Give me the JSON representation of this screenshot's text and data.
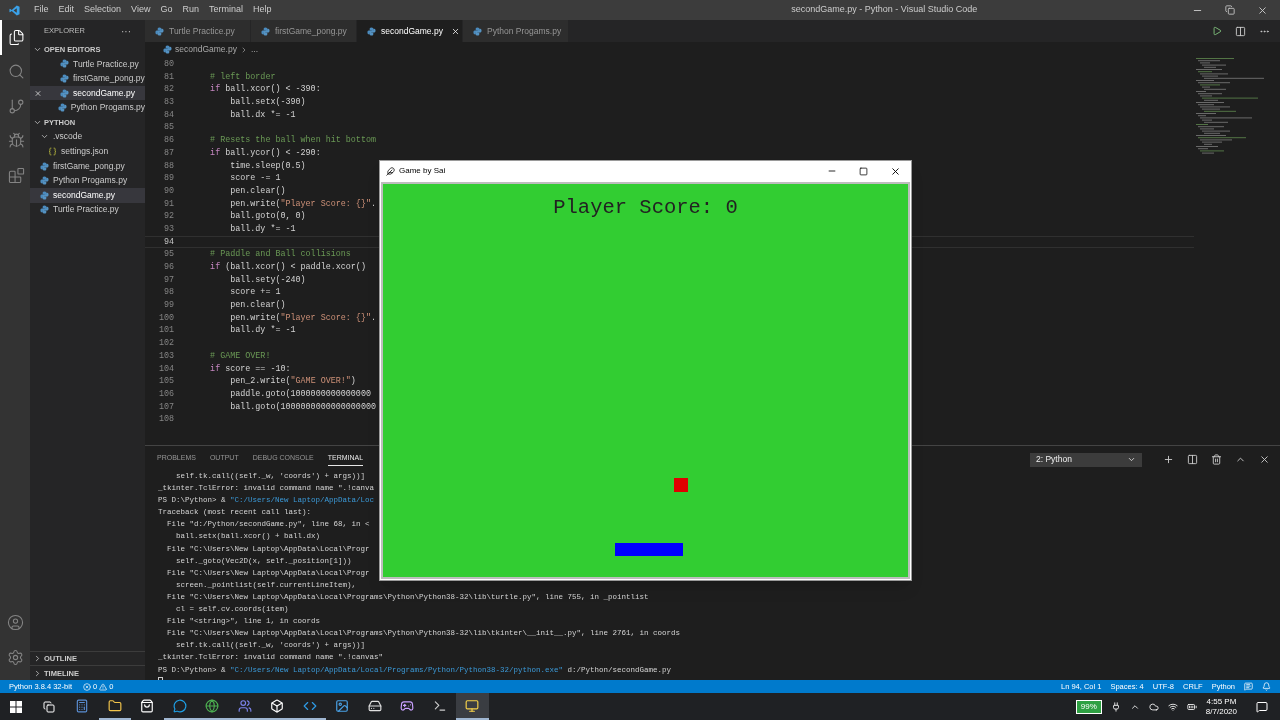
{
  "menu": [
    "File",
    "Edit",
    "Selection",
    "View",
    "Go",
    "Run",
    "Terminal",
    "Help"
  ],
  "window_title": "secondGame.py - Python - Visual Studio Code",
  "activity": [
    {
      "kind": "files",
      "selected": true
    },
    {
      "kind": "search",
      "selected": false
    },
    {
      "kind": "git",
      "selected": false
    },
    {
      "kind": "debug",
      "selected": false
    },
    {
      "kind": "extensions",
      "selected": false
    }
  ],
  "activity_bottom": [
    {
      "kind": "account"
    },
    {
      "kind": "settings"
    }
  ],
  "sidebar": {
    "title": "EXPLORER",
    "more": "···",
    "sections": [
      {
        "label": "OPEN EDITORS",
        "expanded": true,
        "items": [
          {
            "name": "Turtle Practice.py",
            "kind": "python",
            "selected": false,
            "closable": false
          },
          {
            "name": "firstGame_pong.py",
            "kind": "python",
            "selected": false,
            "closable": false
          },
          {
            "name": "secondGame.py",
            "kind": "python",
            "selected": true,
            "closable": true
          },
          {
            "name": "Python Progams.py",
            "kind": "python",
            "selected": false,
            "closable": false
          }
        ]
      },
      {
        "label": "PYTHON",
        "expanded": true,
        "items": [
          {
            "name": ".vscode",
            "kind": "folder",
            "expanded": true,
            "selected": false,
            "children": [
              {
                "name": "settings.json",
                "kind": "json",
                "selected": false
              }
            ]
          },
          {
            "name": "firstGame_pong.py",
            "kind": "python",
            "selected": false
          },
          {
            "name": "Python Progams.py",
            "kind": "python",
            "selected": false
          },
          {
            "name": "secondGame.py",
            "kind": "python",
            "selected": true
          },
          {
            "name": "Turtle Practice.py",
            "kind": "python",
            "selected": false
          }
        ]
      }
    ],
    "bottom": [
      {
        "label": "OUTLINE",
        "expanded": false
      },
      {
        "label": "TIMELINE",
        "expanded": false
      }
    ]
  },
  "tabs": [
    {
      "label": "Turtle Practice.py",
      "selected": false
    },
    {
      "label": "firstGame_pong.py",
      "selected": false
    },
    {
      "label": "secondGame.py",
      "selected": true
    },
    {
      "label": "Python Progams.py",
      "selected": false
    }
  ],
  "breadcrumb": [
    "secondGame.py",
    "..."
  ],
  "code": [
    {
      "n": "80",
      "current": false
    },
    {
      "n": "81",
      "current": false,
      "segs": [
        {
          "text": "    # left border",
          "kind": "comment"
        }
      ]
    },
    {
      "n": "82",
      "current": false,
      "segs": [
        {
          "text": "    if",
          "kind": "keyword"
        },
        {
          "text": " ball.xcor() < -390:",
          "kind": "plain"
        }
      ]
    },
    {
      "n": "83",
      "current": false,
      "segs": [
        {
          "text": "        ball.setx(-390)",
          "kind": "plain"
        }
      ]
    },
    {
      "n": "84",
      "current": false,
      "segs": [
        {
          "text": "        ball.dx *= -1",
          "kind": "plain"
        }
      ]
    },
    {
      "n": "85",
      "current": false
    },
    {
      "n": "86",
      "current": false,
      "segs": [
        {
          "text": "    # Resets the ball when hit bottom",
          "kind": "comment"
        }
      ]
    },
    {
      "n": "87",
      "current": false,
      "segs": [
        {
          "text": "    if",
          "kind": "keyword"
        },
        {
          "text": " ball.ycor() < -290:",
          "kind": "plain"
        }
      ]
    },
    {
      "n": "88",
      "current": false,
      "segs": [
        {
          "text": "        time.sleep(0.5)",
          "kind": "plain"
        }
      ]
    },
    {
      "n": "89",
      "current": false,
      "segs": [
        {
          "text": "        score -= 1",
          "kind": "plain"
        }
      ]
    },
    {
      "n": "90",
      "current": false,
      "segs": [
        {
          "text": "        pen.clear()",
          "kind": "plain"
        }
      ]
    },
    {
      "n": "91",
      "current": false,
      "segs": [
        {
          "text": "        pen.write(",
          "kind": "plain"
        },
        {
          "text": "\"Player Score: {}\"",
          "kind": "string"
        },
        {
          "text": ".",
          "kind": "plain"
        }
      ]
    },
    {
      "n": "92",
      "current": false,
      "segs": [
        {
          "text": "        ball.goto(0, 0)",
          "kind": "plain"
        }
      ]
    },
    {
      "n": "93",
      "current": false,
      "segs": [
        {
          "text": "        ball.dy *= -1",
          "kind": "plain"
        }
      ]
    },
    {
      "n": "94",
      "current": true
    },
    {
      "n": "95",
      "current": false,
      "segs": [
        {
          "text": "    # Paddle and Ball collisions",
          "kind": "comment"
        }
      ]
    },
    {
      "n": "96",
      "current": false,
      "segs": [
        {
          "text": "    if",
          "kind": "keyword"
        },
        {
          "text": " (ball.xcor() < paddle.xcor()",
          "kind": "plain"
        }
      ]
    },
    {
      "n": "97",
      "current": false,
      "segs": [
        {
          "text": "        ball.sety(-240)",
          "kind": "plain"
        }
      ]
    },
    {
      "n": "98",
      "current": false,
      "segs": [
        {
          "text": "        score += 1",
          "kind": "plain"
        }
      ]
    },
    {
      "n": "99",
      "current": false,
      "segs": [
        {
          "text": "        pen.clear()",
          "kind": "plain"
        }
      ]
    },
    {
      "n": "100",
      "current": false,
      "segs": [
        {
          "text": "        pen.write(",
          "kind": "plain"
        },
        {
          "text": "\"Player Score: {}\"",
          "kind": "string"
        },
        {
          "text": ".",
          "kind": "plain"
        }
      ]
    },
    {
      "n": "101",
      "current": false,
      "segs": [
        {
          "text": "        ball.dy *= -1",
          "kind": "plain"
        }
      ]
    },
    {
      "n": "102",
      "current": false
    },
    {
      "n": "103",
      "current": false,
      "segs": [
        {
          "text": "    # GAME OVER!",
          "kind": "comment"
        }
      ]
    },
    {
      "n": "104",
      "current": false,
      "segs": [
        {
          "text": "    if",
          "kind": "keyword"
        },
        {
          "text": " score == -10:",
          "kind": "plain"
        }
      ]
    },
    {
      "n": "105",
      "current": false,
      "segs": [
        {
          "text": "        pen_2.write(",
          "kind": "plain"
        },
        {
          "text": "\"GAME OVER!\"",
          "kind": "string"
        },
        {
          "text": ")",
          "kind": "plain"
        }
      ]
    },
    {
      "n": "106",
      "current": false,
      "segs": [
        {
          "text": "        paddle.goto(1000000000000000",
          "kind": "plain"
        }
      ]
    },
    {
      "n": "107",
      "current": false,
      "segs": [
        {
          "text": "        ball.goto(1000000000000000000",
          "kind": "plain"
        }
      ]
    },
    {
      "n": "108",
      "current": false
    }
  ],
  "panel_tabs": [
    {
      "label": "PROBLEMS",
      "selected": false
    },
    {
      "label": "OUTPUT",
      "selected": false
    },
    {
      "label": "DEBUG CONSOLE",
      "selected": false
    },
    {
      "label": "TERMINAL",
      "selected": true
    }
  ],
  "terminal_select": "2: Python",
  "terminal": [
    {
      "segs": [
        {
          "text": "    self.tk.call((self._w, 'coords') + args))]",
          "kind": "plain"
        }
      ]
    },
    {
      "segs": [
        {
          "text": "_tkinter.TclError: invalid command name \".!canva",
          "kind": "plain"
        }
      ]
    },
    {
      "segs": [
        {
          "text": "PS D:\\Python> & ",
          "kind": "plain"
        },
        {
          "text": "\"C:/Users/New Laptop/AppData/Loc",
          "kind": "path"
        }
      ]
    },
    {
      "segs": [
        {
          "text": "Traceback (most recent call last):",
          "kind": "plain"
        }
      ]
    },
    {
      "segs": [
        {
          "text": "  File \"d:/Python/secondGame.py\", line 68, in <",
          "kind": "plain"
        }
      ]
    },
    {
      "segs": [
        {
          "text": "    ball.setx(ball.xcor() + ball.dx)",
          "kind": "plain"
        }
      ]
    },
    {
      "segs": [
        {
          "text": "  File \"C:\\Users\\New Laptop\\AppData\\Local\\Progr",
          "kind": "plain"
        }
      ]
    },
    {
      "segs": [
        {
          "text": "    self._goto(Vec2D(x, self._position[1]))",
          "kind": "plain"
        }
      ]
    },
    {
      "segs": [
        {
          "text": "  File \"C:\\Users\\New Laptop\\AppData\\Local\\Progr",
          "kind": "plain"
        }
      ]
    },
    {
      "segs": [
        {
          "text": "    screen._pointlist(self.currentLineItem),",
          "kind": "plain"
        }
      ]
    },
    {
      "segs": [
        {
          "text": "  File \"C:\\Users\\New Laptop\\AppData\\Local\\Programs\\Python\\Python38-32\\lib\\turtle.py\", line 755, in _pointlist",
          "kind": "plain"
        }
      ]
    },
    {
      "segs": [
        {
          "text": "    cl = self.cv.coords(item)",
          "kind": "plain"
        }
      ]
    },
    {
      "segs": [
        {
          "text": "  File \"<string>\", line 1, in coords",
          "kind": "plain"
        }
      ]
    },
    {
      "segs": [
        {
          "text": "  File \"C:\\Users\\New Laptop\\AppData\\Local\\Programs\\Python\\Python38-32\\lib\\tkinter\\__init__.py\", line 2761, in coords",
          "kind": "plain"
        }
      ]
    },
    {
      "segs": [
        {
          "text": "    self.tk.call((self._w, 'coords') + args))]",
          "kind": "plain"
        }
      ]
    },
    {
      "segs": [
        {
          "text": "_tkinter.TclError: invalid command name \".!canvas\"",
          "kind": "plain"
        }
      ]
    },
    {
      "segs": [
        {
          "text": "PS D:\\Python> & ",
          "kind": "plain"
        },
        {
          "text": "\"C:/Users/New Laptop/AppData/Local/Programs/Python/Python38-32/python.exe\"",
          "kind": "path"
        },
        {
          "text": " d:/Python/secondGame.py",
          "kind": "plain"
        }
      ]
    }
  ],
  "status": {
    "interpreter": "Python 3.8.4 32-bit",
    "errors": "0",
    "warnings": "0",
    "right": [
      "Ln 94, Col 1",
      "Spaces: 4",
      "UTF-8",
      "CRLF",
      "Python"
    ]
  },
  "game": {
    "title": "Game by Sai",
    "score": "Player Score: 0"
  },
  "taskbar": [
    {
      "kind": "calculator",
      "running": false,
      "selected": false
    },
    {
      "kind": "folder",
      "running": true,
      "selected": false
    },
    {
      "kind": "store",
      "running": false,
      "selected": false
    },
    {
      "kind": "chat",
      "running": true,
      "selected": false
    },
    {
      "kind": "browser",
      "running": true,
      "selected": false
    },
    {
      "kind": "team",
      "running": true,
      "selected": false
    },
    {
      "kind": "cube",
      "running": true,
      "selected": false
    },
    {
      "kind": "code",
      "running": true,
      "selected": false
    },
    {
      "kind": "image",
      "running": false,
      "selected": false
    },
    {
      "kind": "drive",
      "running": false,
      "selected": false
    },
    {
      "kind": "game",
      "running": false,
      "selected": false
    },
    {
      "kind": "terminal",
      "running": false,
      "selected": false
    },
    {
      "kind": "python",
      "running": true,
      "selected": true
    }
  ],
  "tray": {
    "battery": "99%",
    "time": "4:55 PM",
    "date": "8/7/2020"
  }
}
